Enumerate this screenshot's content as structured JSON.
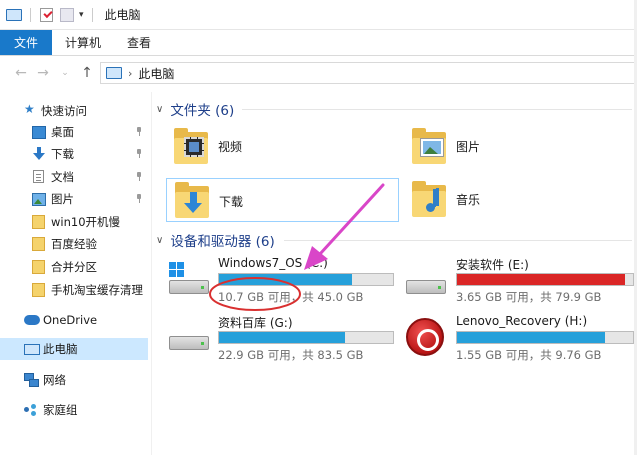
{
  "window": {
    "title": "此电脑"
  },
  "ribbon": {
    "tabs": [
      "文件",
      "计算机",
      "查看"
    ]
  },
  "address": {
    "crumb": "此电脑"
  },
  "sidebar": {
    "quick_access": "快速访问",
    "items": [
      {
        "label": "桌面",
        "icon": "desktop-icon",
        "pinned": true
      },
      {
        "label": "下载",
        "icon": "download-icon",
        "pinned": true
      },
      {
        "label": "文档",
        "icon": "document-icon",
        "pinned": true
      },
      {
        "label": "图片",
        "icon": "pictures-icon",
        "pinned": true
      },
      {
        "label": "win10开机慢",
        "icon": "folder-icon",
        "pinned": false
      },
      {
        "label": "百度经验",
        "icon": "folder-icon",
        "pinned": false
      },
      {
        "label": "合并分区",
        "icon": "folder-icon",
        "pinned": false
      },
      {
        "label": "手机淘宝缓存清理",
        "icon": "folder-icon",
        "pinned": false
      }
    ],
    "onedrive": "OneDrive",
    "this_pc": "此电脑",
    "network": "网络",
    "homegroup": "家庭组"
  },
  "folders_section": {
    "title": "文件夹 (6)",
    "folders": [
      "视频",
      "图片",
      "下载",
      "音乐"
    ]
  },
  "drives_section": {
    "title": "设备和驱动器 (6)",
    "drives": [
      {
        "name": "Windows7_OS (C:)",
        "info": "10.7 GB 可用，共 45.0 GB",
        "used_fraction": 0.762,
        "color": "#26a0da"
      },
      {
        "name": "安装软件 (E:)",
        "info": "3.65 GB 可用，共 79.9 GB",
        "used_fraction": 0.954,
        "color": "#da2626"
      },
      {
        "name": "资料百库 (G:)",
        "info": "22.9 GB 可用，共 83.5 GB",
        "used_fraction": 0.726,
        "color": "#26a0da"
      },
      {
        "name": "Lenovo_Recovery (H:)",
        "info": "1.55 GB 可用，共 9.76 GB",
        "used_fraction": 0.841,
        "color": "#26a0da"
      }
    ]
  },
  "annotation": {
    "color": "#d946c8",
    "circle_color": "#d93030"
  }
}
